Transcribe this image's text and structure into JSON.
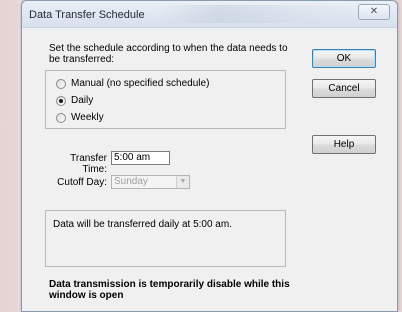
{
  "window": {
    "title": "Data Transfer Schedule",
    "close_symbol": "✕"
  },
  "schedule": {
    "instruction": "Set the schedule according to when the data needs to be transferred:",
    "options": [
      {
        "label": "Manual (no specified schedule)",
        "checked": false
      },
      {
        "label": "Daily",
        "checked": true
      },
      {
        "label": "Weekly",
        "checked": false
      }
    ]
  },
  "transfer_time": {
    "label": "Transfer Time:",
    "value": "5:00 am"
  },
  "cutoff_day": {
    "label": "Cutoff Day:",
    "value": "Sunday",
    "arrow": "▼"
  },
  "info": {
    "text": "Data will be transferred daily at 5:00 am."
  },
  "warning": {
    "text": "Data transmission is temporarily disable while this window is open"
  },
  "buttons": {
    "ok": "OK",
    "cancel": "Cancel",
    "help": "Help"
  }
}
